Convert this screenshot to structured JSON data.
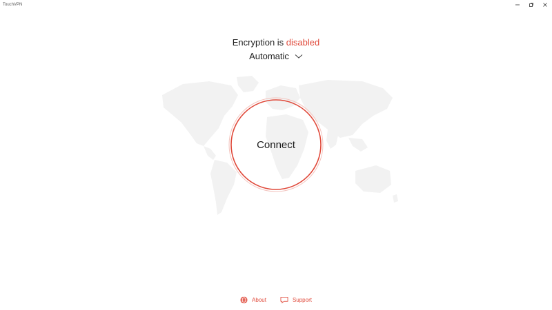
{
  "app": {
    "title": "TouchVPN"
  },
  "status": {
    "prefix": "Encryption is",
    "state": "disabled"
  },
  "protocol": {
    "selected": "Automatic"
  },
  "connect": {
    "label": "Connect"
  },
  "footer": {
    "about_label": "About",
    "support_label": "Support"
  },
  "icons": {
    "minimize": "minimize-icon",
    "maximize": "maximize-icon",
    "close": "close-icon",
    "dropdown": "chevron-down-icon",
    "about": "globe-icon",
    "support": "chat-bubble-icon",
    "map": "world-map-icon"
  },
  "colors": {
    "accent": "#e0493a",
    "map": "#f2f2f2",
    "text": "#222222"
  }
}
